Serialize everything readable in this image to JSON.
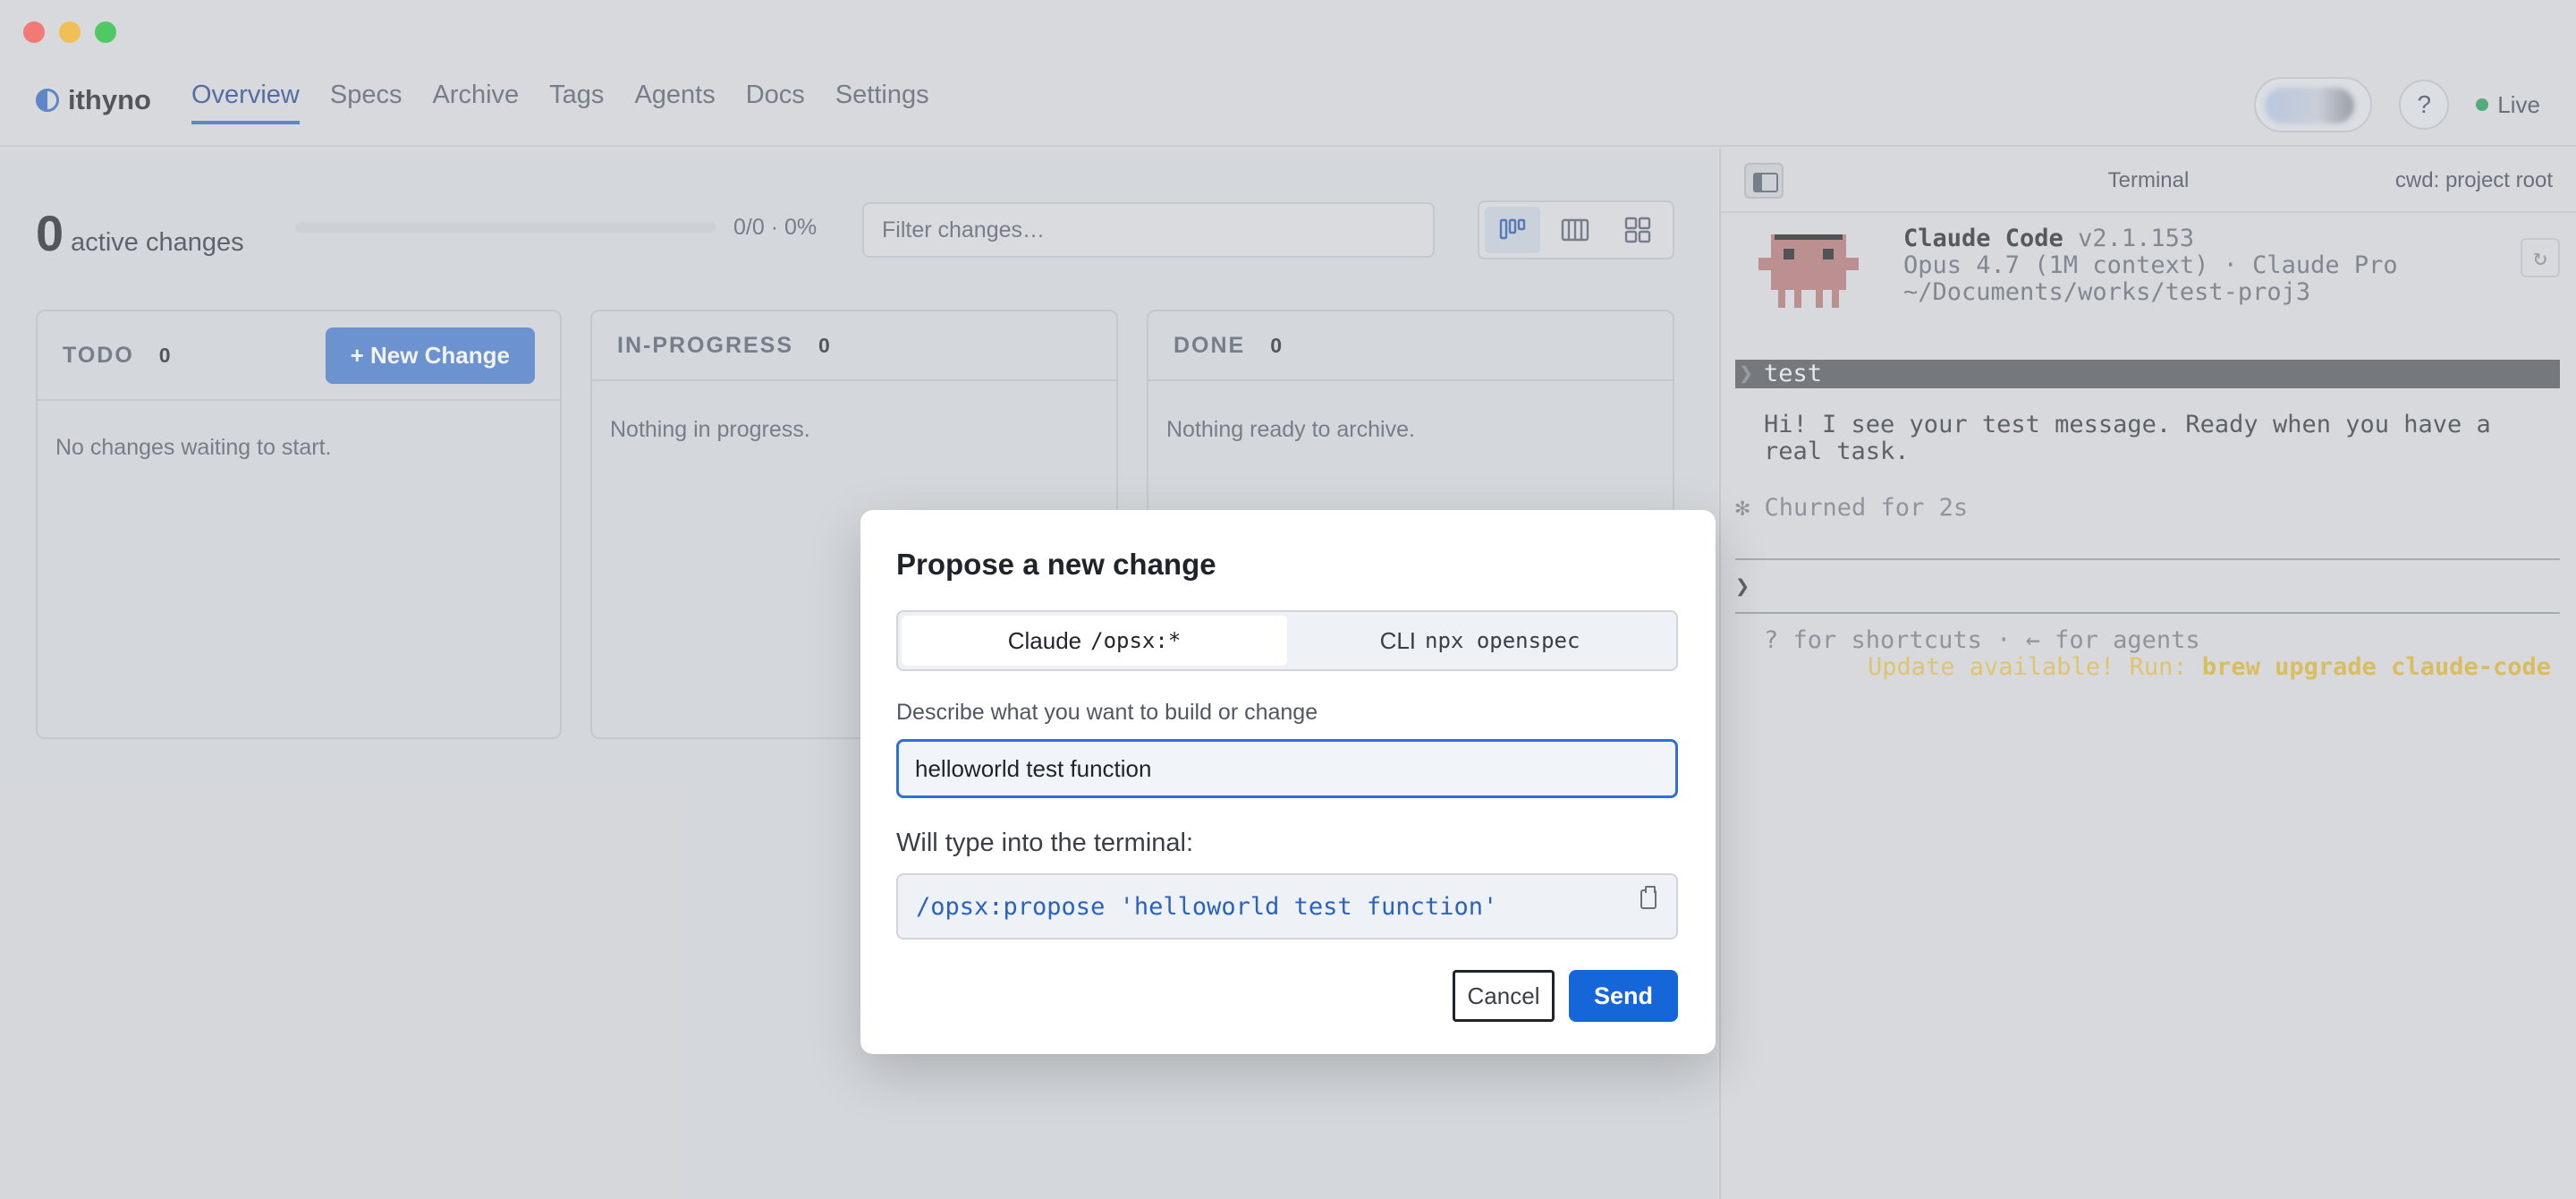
{
  "nav": {
    "brand": "ithyno",
    "tabs": [
      {
        "label": "Overview",
        "active": true
      },
      {
        "label": "Specs"
      },
      {
        "label": "Archive"
      },
      {
        "label": "Tags"
      },
      {
        "label": "Agents"
      },
      {
        "label": "Docs"
      },
      {
        "label": "Settings"
      }
    ],
    "help": "?",
    "status": "Live",
    "status_color": "#2fa05a"
  },
  "summary": {
    "count": "0",
    "label": "active changes",
    "progress_text": "0/0 · 0%",
    "progress_value": 0
  },
  "filter": {
    "placeholder": "Filter changes…"
  },
  "columns": [
    {
      "title": "TODO",
      "count": "0",
      "empty": "No changes waiting to start.",
      "action": "+ New Change"
    },
    {
      "title": "IN-PROGRESS",
      "count": "0",
      "empty": "Nothing in progress."
    },
    {
      "title": "DONE",
      "count": "0",
      "empty": "Nothing ready to archive."
    }
  ],
  "terminal": {
    "title": "Terminal",
    "cwd": "cwd: project root",
    "app_name": "Claude Code",
    "version": "v2.1.153",
    "model": "Opus 4.7 (1M context) · Claude Pro",
    "path": "~/Documents/works/test-proj3",
    "user_prompt": "test",
    "reply": "Hi! I see your test message. Ready when you have a real task.",
    "churn": "✻ Churned for 2s",
    "input_caret": "❯",
    "shortcuts": "? for shortcuts · ← for agents",
    "update_text": "Update available! Run:",
    "update_cmd": "brew upgrade claude-code",
    "refresh": "↻"
  },
  "modal": {
    "title": "Propose a new change",
    "tabs": [
      {
        "label": "Claude",
        "code": "/opsx:*",
        "active": true
      },
      {
        "label": "CLI",
        "code": "npx openspec"
      }
    ],
    "field_label": "Describe what you want to build or change",
    "field_value": "helloworld test function",
    "preview_label": "Will type into the terminal:",
    "preview_command": "/opsx:propose 'helloworld test function'",
    "cancel": "Cancel",
    "send": "Send",
    "accent": "#1466d9"
  }
}
